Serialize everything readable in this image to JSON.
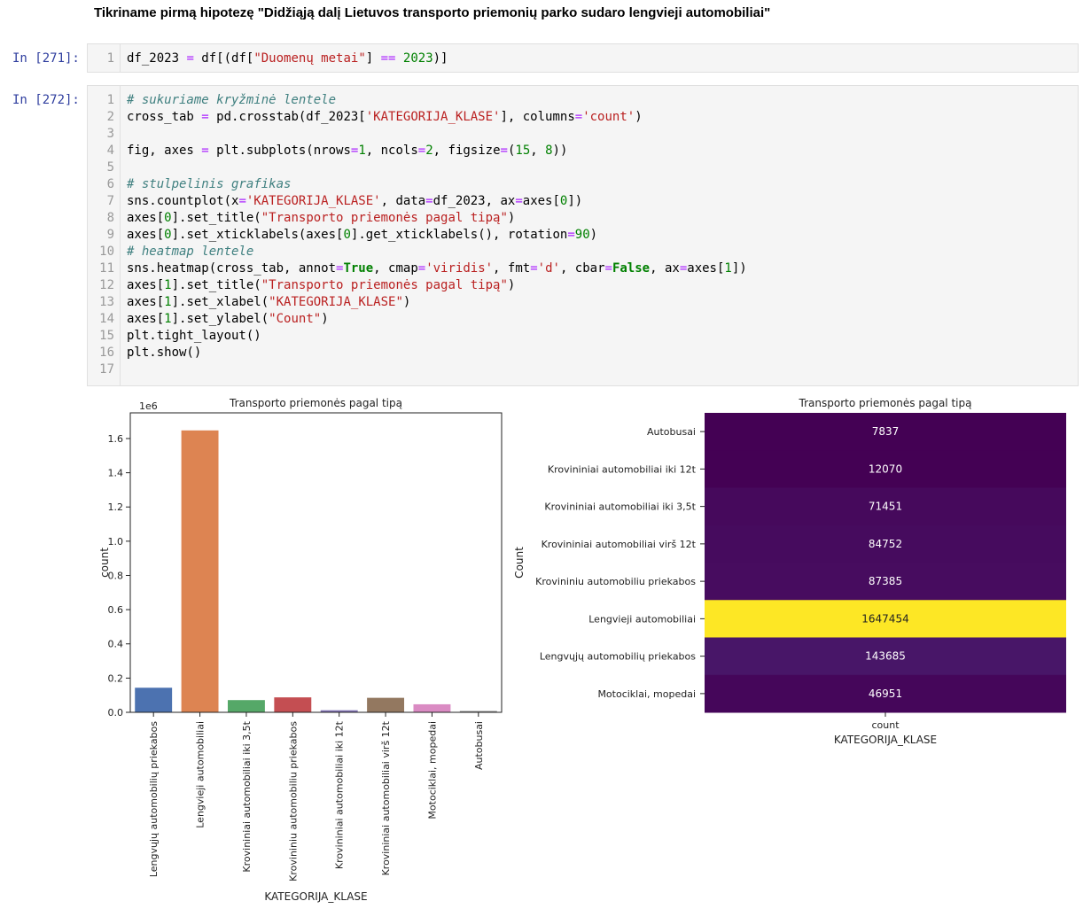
{
  "heading": "Tikriname pirmą hipotezę \"Didžiąją dalį Lietuvos transporto priemonių parko sudaro lengvieji automobiliai\"",
  "cells": [
    {
      "prompt": "In [271]:",
      "lines": [
        {
          "n": "1",
          "code": "df_2023 = df[(df[\"Duomenų metai\"] == 2023)]"
        }
      ]
    },
    {
      "prompt": "In [272]:",
      "lines": [
        {
          "n": "1",
          "code": "# sukuriame kryžminė lentele"
        },
        {
          "n": "2",
          "code": "cross_tab = pd.crosstab(df_2023['KATEGORIJA_KLASE'], columns='count')"
        },
        {
          "n": "3",
          "code": ""
        },
        {
          "n": "4",
          "code": "fig, axes = plt.subplots(nrows=1, ncols=2, figsize=(15, 8))"
        },
        {
          "n": "5",
          "code": ""
        },
        {
          "n": "6",
          "code": "# stulpelinis grafikas"
        },
        {
          "n": "7",
          "code": "sns.countplot(x='KATEGORIJA_KLASE', data=df_2023, ax=axes[0])"
        },
        {
          "n": "8",
          "code": "axes[0].set_title(\"Transporto priemonės pagal tipą\")"
        },
        {
          "n": "9",
          "code": "axes[0].set_xticklabels(axes[0].get_xticklabels(), rotation=90)"
        },
        {
          "n": "10",
          "code": "# heatmap lentele"
        },
        {
          "n": "11",
          "code": "sns.heatmap(cross_tab, annot=True, cmap='viridis', fmt='d', cbar=False, ax=axes[1])"
        },
        {
          "n": "12",
          "code": "axes[1].set_title(\"Transporto priemonės pagal tipą\")"
        },
        {
          "n": "13",
          "code": "axes[1].set_xlabel(\"KATEGORIJA_KLASE\")"
        },
        {
          "n": "14",
          "code": "axes[1].set_ylabel(\"Count\")"
        },
        {
          "n": "15",
          "code": "plt.tight_layout()"
        },
        {
          "n": "16",
          "code": "plt.show()"
        },
        {
          "n": "17",
          "code": ""
        }
      ]
    }
  ],
  "chart_data": [
    {
      "type": "bar",
      "title": "Transporto priemonės pagal tipą",
      "xlabel": "KATEGORIJA_KLASE",
      "ylabel": "count",
      "y_offset_label": "1e6",
      "categories": [
        "Lengvųjų automobilių priekabos",
        "Lengvieji automobiliai",
        "Krovininiai automobiliai iki 3,5t",
        "Krovininiu automobiliu priekabos",
        "Krovininiai automobiliai iki 12t",
        "Krovininiai automobiliai virš 12t",
        "Motociklai, mopedai",
        "Autobusai"
      ],
      "values": [
        143685,
        1647454,
        71451,
        87385,
        12070,
        84752,
        46951,
        7837
      ],
      "colors": [
        "#4c72b0",
        "#dd8452",
        "#55a868",
        "#c44e52",
        "#8172b3",
        "#937860",
        "#da8bc3",
        "#8c8c8c"
      ],
      "ylim": [
        0,
        1750000
      ],
      "yticks": [
        "0.0",
        "0.2",
        "0.4",
        "0.6",
        "0.8",
        "1.0",
        "1.2",
        "1.4",
        "1.6"
      ],
      "grid": false
    },
    {
      "type": "heatmap",
      "title": "Transporto priemonės pagal tipą",
      "xlabel": "KATEGORIJA_KLASE",
      "ylabel": "Count",
      "cmap": "viridis",
      "columns": [
        "count"
      ],
      "rows": [
        "Autobusai",
        "Krovininiai automobiliai iki 12t",
        "Krovininiai automobiliai iki 3,5t",
        "Krovininiai automobiliai virš 12t",
        "Krovininiu automobiliu priekabos",
        "Lengvieji automobiliai",
        "Lengvųjų automobilių priekabos",
        "Motociklai, mopedai"
      ],
      "values": [
        7837,
        12070,
        71451,
        84752,
        87385,
        1647454,
        143685,
        46951
      ],
      "colors": [
        "#440154",
        "#440154",
        "#46095c",
        "#460b5e",
        "#470c5f",
        "#fde725",
        "#481668",
        "#45065a"
      ],
      "text_colors": [
        "#ffffff",
        "#ffffff",
        "#ffffff",
        "#ffffff",
        "#ffffff",
        "#222222",
        "#ffffff",
        "#ffffff"
      ]
    }
  ]
}
